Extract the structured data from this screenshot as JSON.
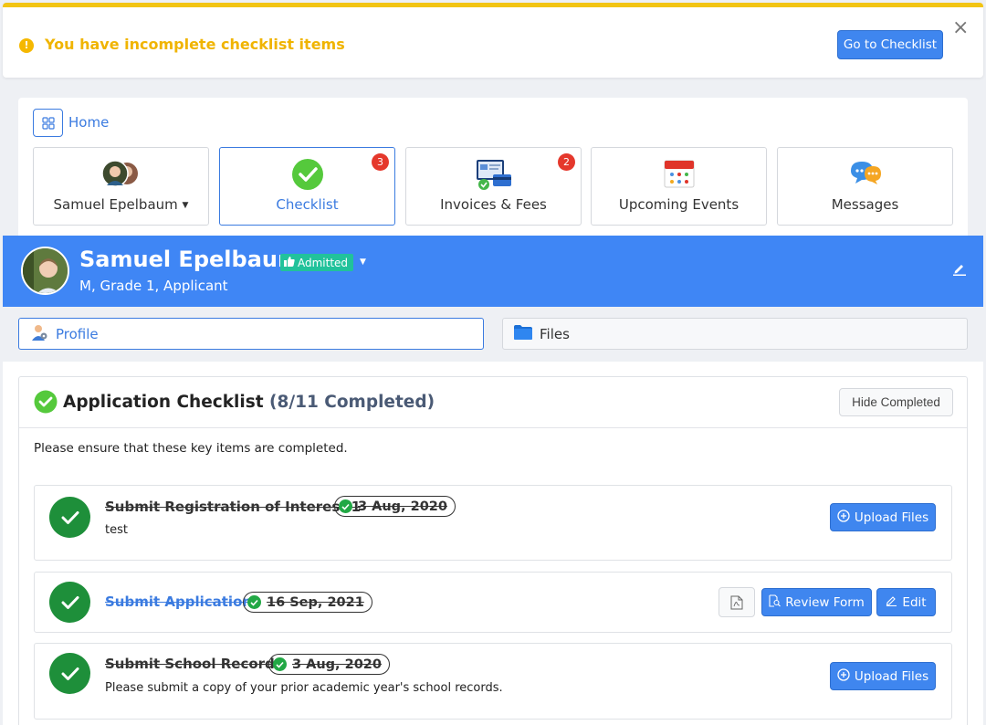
{
  "alert": {
    "message": "You have incomplete checklist items",
    "button_label": "Go to Checklist",
    "close": "×"
  },
  "home": {
    "label": "Home",
    "tiles": [
      {
        "label": "Samuel Epelbaum",
        "icon": "family-avatars-icon",
        "caret": true
      },
      {
        "label": "Checklist",
        "icon": "green-check-icon",
        "badge": "3"
      },
      {
        "label": "Invoices & Fees",
        "icon": "invoice-icon",
        "badge": "2"
      },
      {
        "label": "Upcoming Events",
        "icon": "calendar-icon"
      },
      {
        "label": "Messages",
        "icon": "chat-bubbles-icon"
      }
    ]
  },
  "student": {
    "name": "Samuel Epelbaum",
    "status": "Admitted",
    "subtitle": "M, Grade 1, Applicant"
  },
  "tabs": [
    {
      "label": "Profile",
      "active": true
    },
    {
      "label": "Files",
      "active": false
    }
  ],
  "checklist": {
    "title": "Application Checklist",
    "count": "(8/11 Completed)",
    "hide_button": "Hide Completed",
    "intro": "Please ensure that these key items are completed.",
    "items": [
      {
        "title": "Submit Registration of Interest 1",
        "date": "3 Aug, 2020",
        "description": "test",
        "action": "Upload Files"
      },
      {
        "title": "Submit Application",
        "date": "16 Sep, 2021",
        "description": "",
        "review": "Review Form",
        "edit": "Edit"
      },
      {
        "title": "Submit School Records",
        "date": "3 Aug, 2020",
        "description": "Please submit a copy of your prior academic year's school records.",
        "action": "Upload Files"
      }
    ]
  },
  "colors": {
    "primary": "#3f86ef",
    "header_blue": "#3f86f5",
    "alert_yellow": "#f0b400",
    "success_green": "#1e8f3a",
    "badge_red": "#e5382c",
    "admitted_teal": "#21c29b"
  }
}
